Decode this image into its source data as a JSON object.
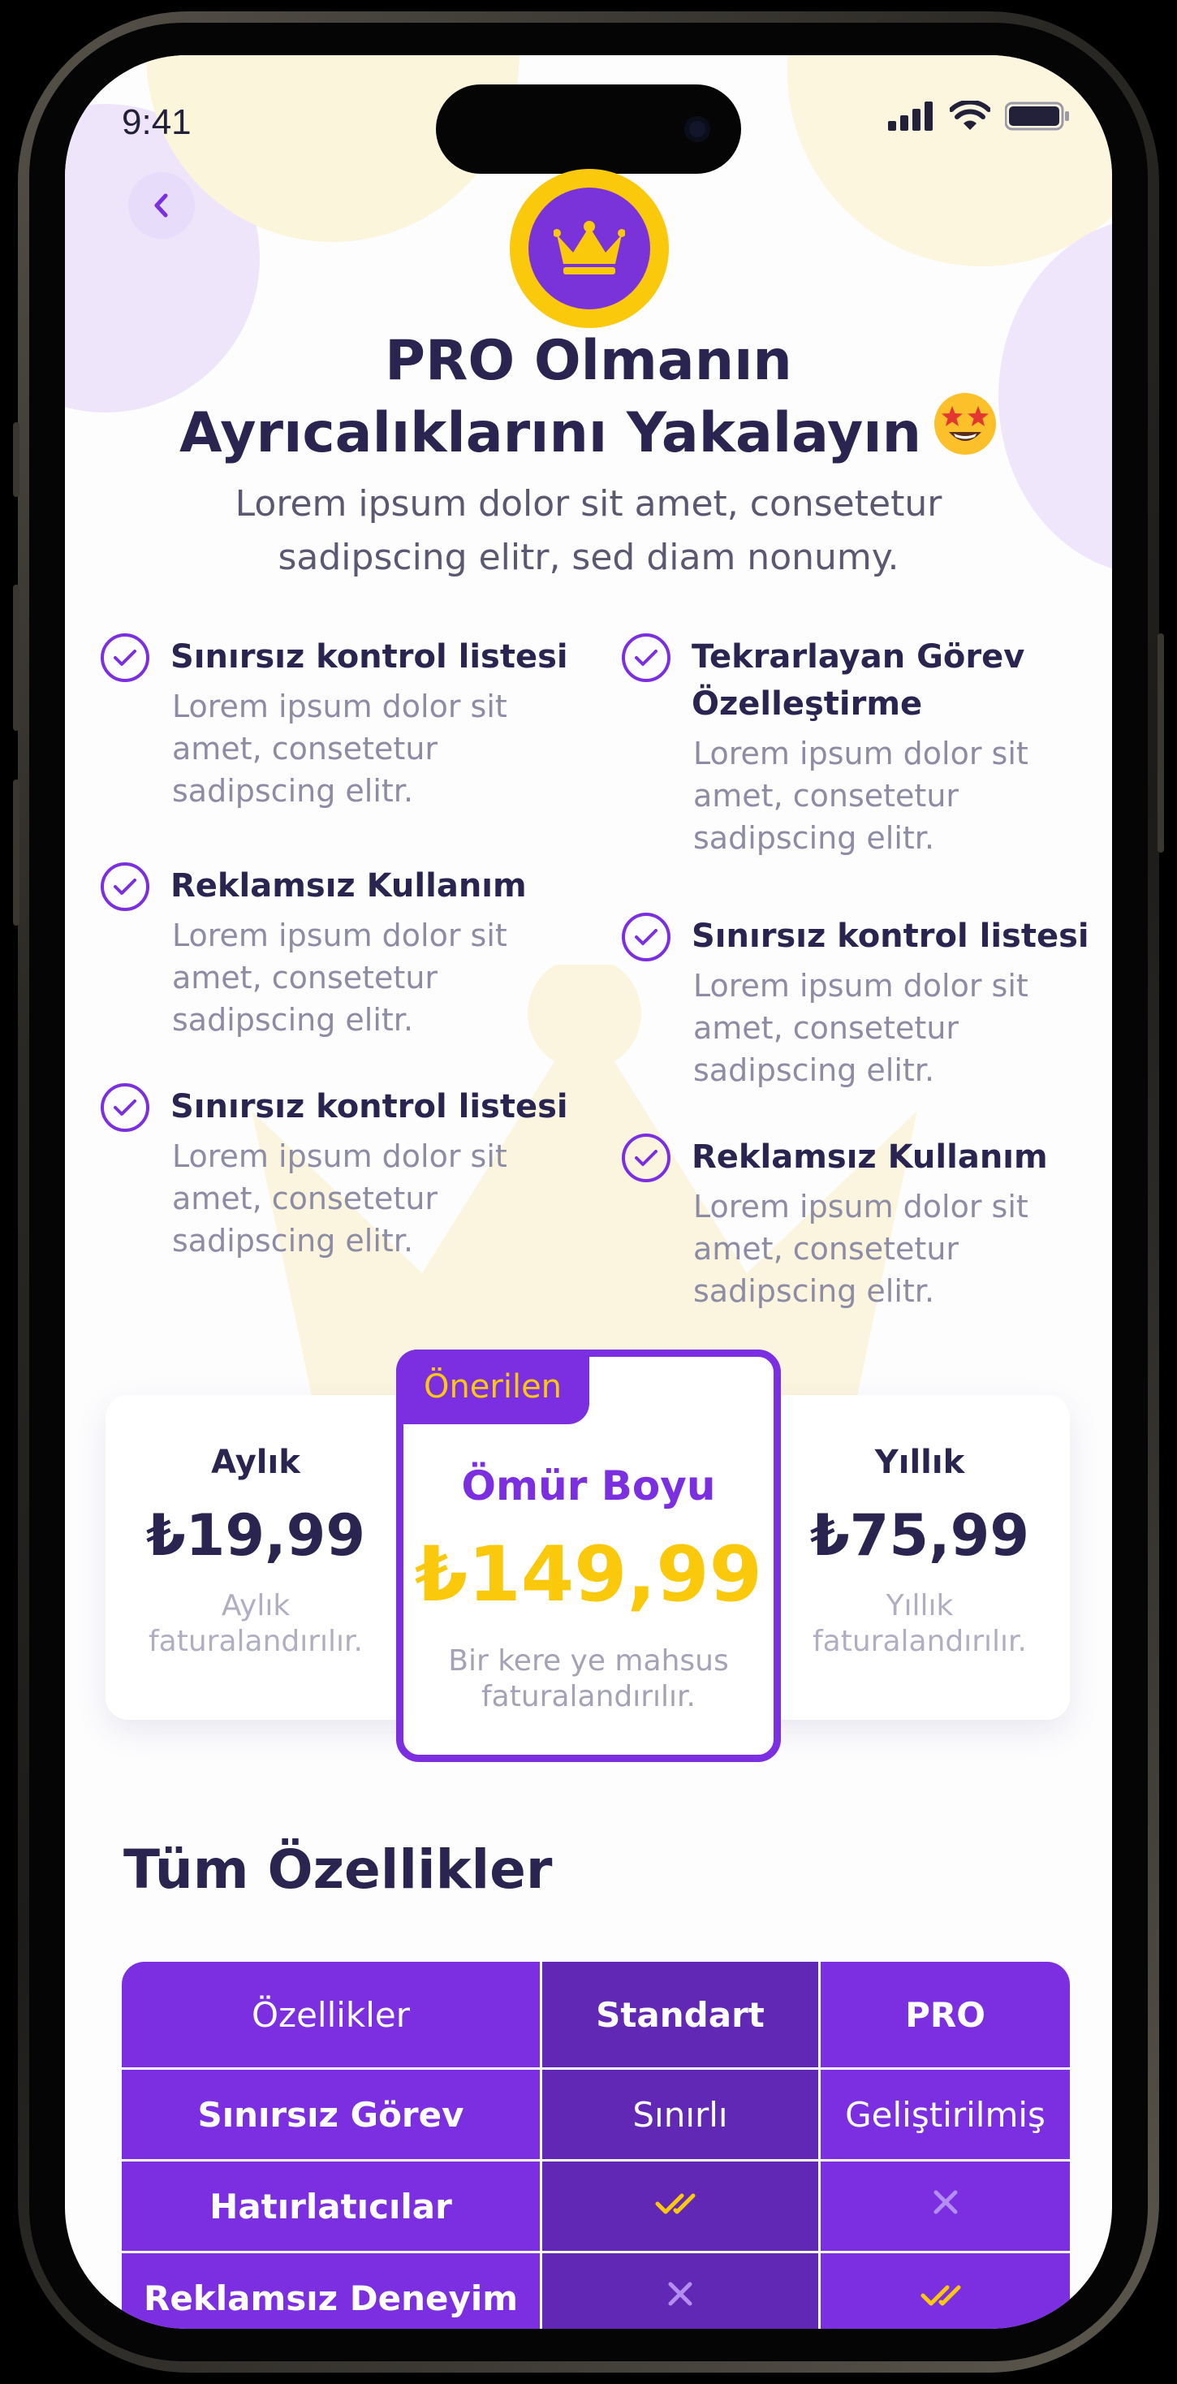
{
  "status": {
    "time": "9:41"
  },
  "hero": {
    "title_line1": "PRO Olmanın",
    "title_line2": "Ayrıcalıklarını Yakalayın",
    "title_emoji": "🤩",
    "subtitle_line1": "Lorem ipsum dolor sit amet, consetetur",
    "subtitle_line2": "sadipscing elitr, sed diam nonumy."
  },
  "features": {
    "left": [
      {
        "title": "Sınırsız kontrol listesi",
        "desc": [
          "Lorem ipsum dolor sit",
          "amet, consetetur",
          "sadipscing elitr."
        ]
      },
      {
        "title": "Reklamsız Kullanım",
        "desc": [
          "Lorem ipsum dolor sit",
          "amet, consetetur",
          "sadipscing elitr."
        ]
      },
      {
        "title": "Sınırsız kontrol listesi",
        "desc": [
          "Lorem ipsum dolor sit",
          "amet, consetetur",
          "sadipscing elitr."
        ]
      }
    ],
    "right": [
      {
        "title": [
          "Tekrarlayan Görev",
          "Özelleştirme"
        ],
        "desc": [
          "Lorem ipsum dolor sit",
          "amet, consetetur",
          "sadipscing elitr."
        ]
      },
      {
        "title": "Sınırsız kontrol listesi",
        "desc": [
          "Lorem ipsum dolor sit",
          "amet, consetetur",
          "sadipscing elitr."
        ]
      },
      {
        "title": "Reklamsız Kullanım",
        "desc": [
          "Lorem ipsum dolor sit",
          "amet, consetetur",
          "sadipscing elitr."
        ]
      }
    ]
  },
  "plans": {
    "monthly": {
      "name": "Aylık",
      "price": "₺19,99",
      "note_line1": "Aylık",
      "note_line2": "faturalandırılır."
    },
    "lifetime": {
      "tag": "Önerilen",
      "name": "Ömür Boyu",
      "price": "₺149,99",
      "note_line1": "Bir kere ye mahsus",
      "note_line2": "faturalandırılır."
    },
    "yearly": {
      "name": "Yıllık",
      "price": "₺75,99",
      "note_line1": "Yıllık",
      "note_line2": "faturalandırılır."
    }
  },
  "comparison": {
    "title": "Tüm Özellikler",
    "headers": [
      "Özellikler",
      "Standart",
      "PRO"
    ],
    "rows": [
      {
        "feature": "Sınırsız Görev",
        "standard": "Sınırlı",
        "pro": "Geliştirilmiş"
      },
      {
        "feature": "Hatırlatıcılar",
        "standard_icon": "double-check-icon",
        "pro_icon": "cross-icon"
      },
      {
        "feature": "Reklamsız Deneyim",
        "standard_icon": "cross-icon",
        "pro_icon": "double-check-icon"
      }
    ]
  },
  "colors": {
    "accent_purple": "#7b2fe0",
    "dark_purple": "#6128b6",
    "gold": "#fbc90c",
    "text_dark": "#2a2550",
    "text_muted": "#8e8ca4"
  }
}
